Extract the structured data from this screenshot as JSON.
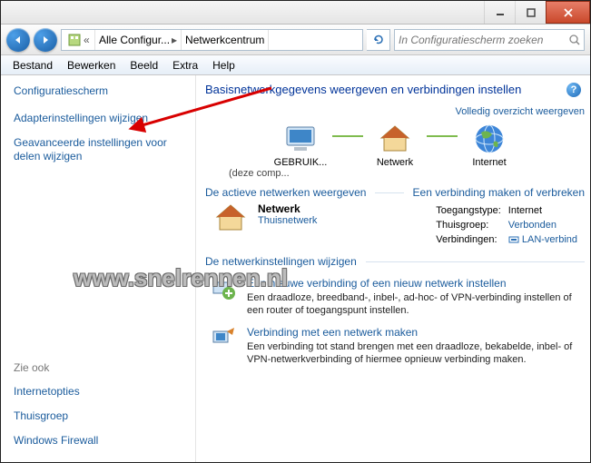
{
  "titlebar": {},
  "nav": {
    "crumb1": "Alle Configur...",
    "crumb2": "Netwerkcentrum",
    "search_placeholder": "In Configuratiescherm zoeken"
  },
  "menu": {
    "file": "Bestand",
    "edit": "Bewerken",
    "view": "Beeld",
    "extra": "Extra",
    "help": "Help"
  },
  "sidebar": {
    "header": "Configuratiescherm",
    "tasks": {
      "adapter": "Adapterinstellingen wijzigen",
      "advanced": "Geavanceerde instellingen voor delen wijzigen"
    },
    "seealso_hdr": "Zie ook",
    "seealso": {
      "internet_options": "Internetopties",
      "homegroup": "Thuisgroep",
      "firewall": "Windows Firewall"
    }
  },
  "content": {
    "title": "Basisnetwerkgegevens weergeven en verbindingen instellen",
    "map": {
      "pc": "GEBRUIK...",
      "pc_sub": "(deze comp...",
      "network": "Netwerk",
      "internet": "Internet",
      "full_link": "Volledig overzicht weergeven"
    },
    "active_hdr": "De actieve netwerken weergeven",
    "active_link": "Een verbinding maken of verbreken",
    "active": {
      "name": "Netwerk",
      "type": "Thuisnetwerk",
      "access_lbl": "Toegangstype:",
      "access_val": "Internet",
      "homegroup_lbl": "Thuisgroep:",
      "homegroup_val": "Verbonden",
      "conn_lbl": "Verbindingen:",
      "conn_val": "LAN-verbind"
    },
    "settings_hdr": "De netwerkinstellingen wijzigen",
    "tasks": {
      "new_title": "Een nieuwe verbinding of een nieuw netwerk instellen",
      "new_desc": "Een draadloze, breedband-, inbel-, ad-hoc- of VPN-verbinding instellen of een router of toegangspunt instellen.",
      "connect_title": "Verbinding met een netwerk maken",
      "connect_desc": "Een verbinding tot stand brengen met een draadloze, bekabelde, inbel- of VPN-netwerkverbinding of hiermee opnieuw verbinding maken."
    }
  },
  "watermark": "www.snelrennen.nl"
}
